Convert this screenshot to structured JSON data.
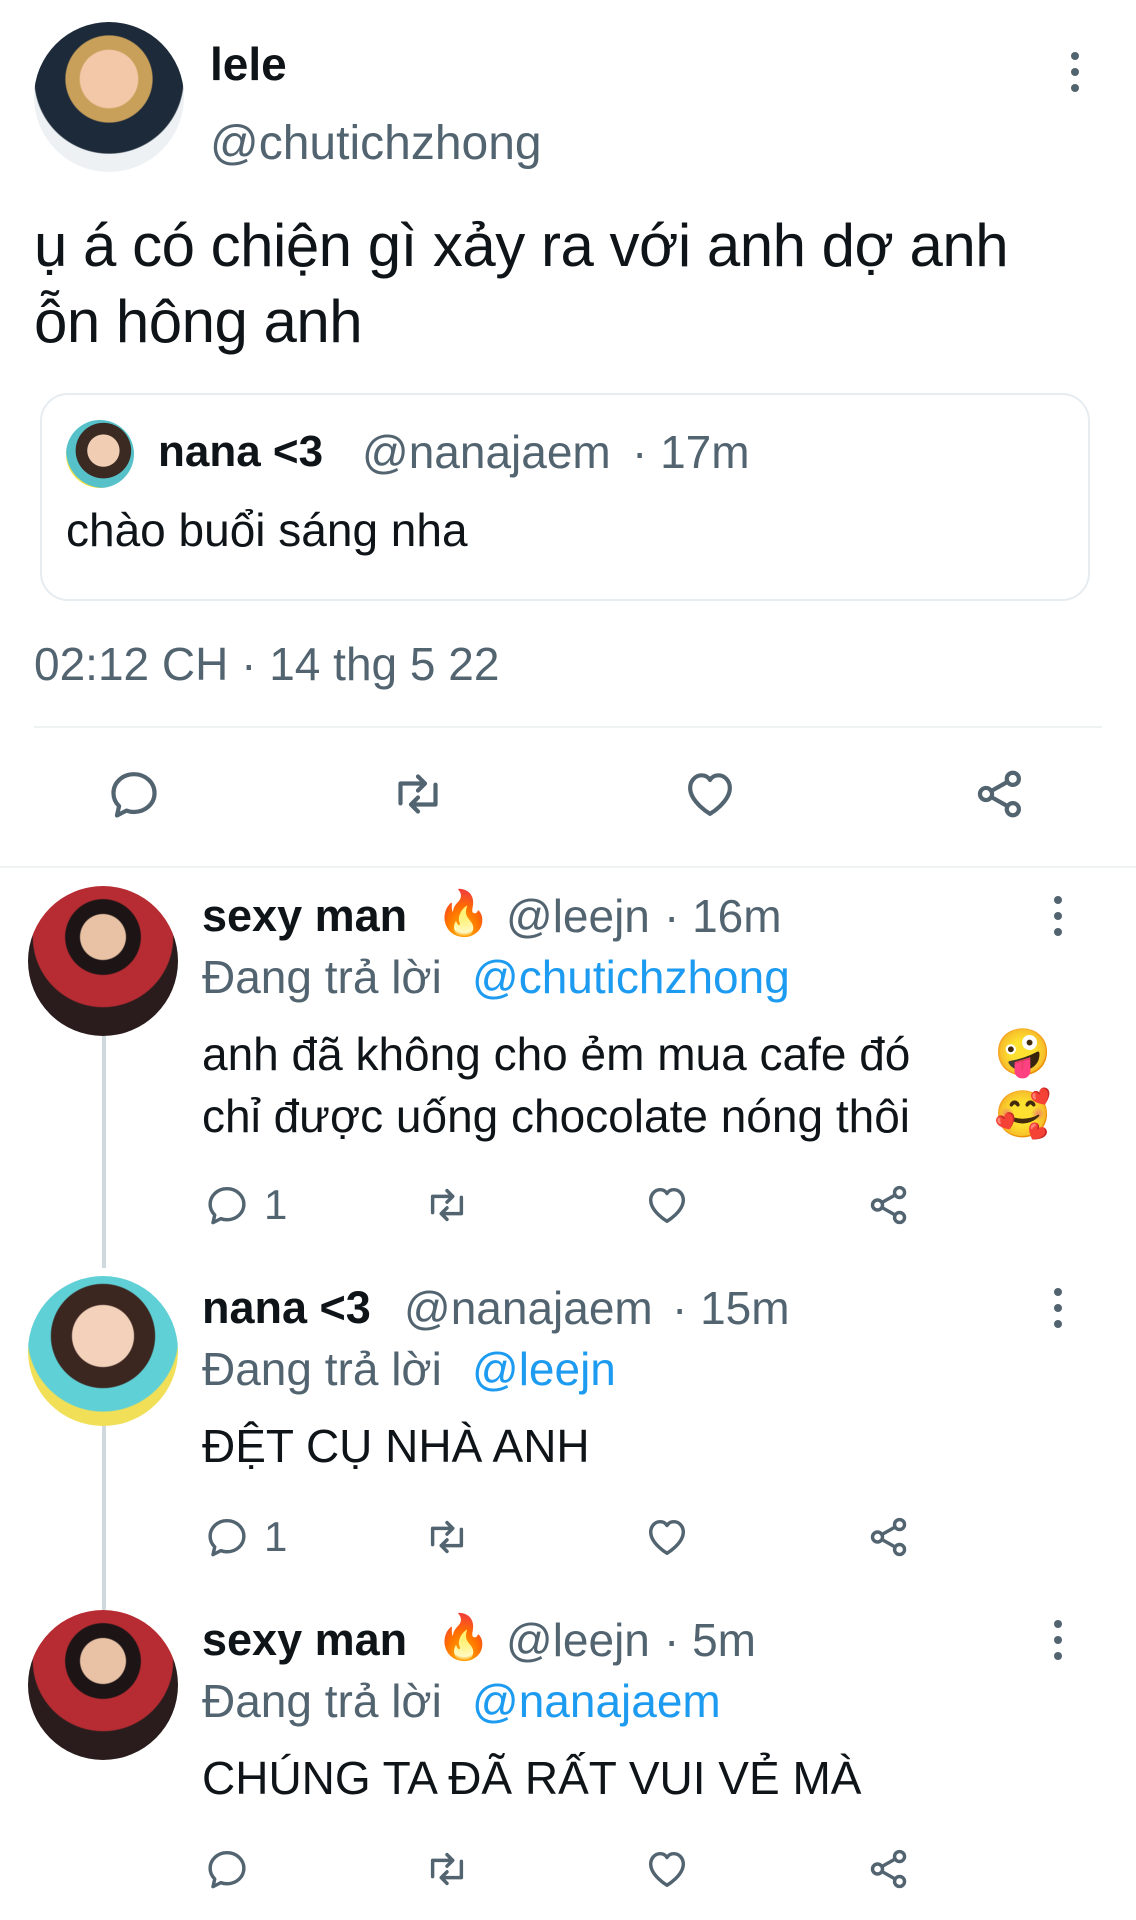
{
  "main_tweet": {
    "name": "lele",
    "handle": "@chutichzhong",
    "text_line1": "ụ á có chiện gì xảy ra với anh dợ anh",
    "text_line2": "ỗn hông anh",
    "quoted": {
      "name": "nana <3",
      "handle": "@nanajaem",
      "time": "· 17m",
      "text": "chào buổi sáng nha"
    },
    "timestamp": "02:12 CH · 14 thg 5 22"
  },
  "actions": {
    "reply_icon": "reply-icon",
    "retweet_icon": "retweet-icon",
    "like_icon": "heart-icon",
    "share_icon": "share-icon"
  },
  "replies": [
    {
      "name": "sexy man",
      "emoji": "🔥",
      "handle": "@leejn",
      "time": "· 16m",
      "replying_prefix": "Đang trả lời",
      "replying_to": "@chutichzhong",
      "line1": "anh đã không cho ẻm mua cafe đó",
      "line1_emoji": "🤪",
      "line2": "chỉ được uống chocolate nóng thôi",
      "line2_emoji": "🥰",
      "reply_count": "1"
    },
    {
      "name": "nana <3",
      "handle": "@nanajaem",
      "time": "· 15m",
      "replying_prefix": "Đang trả lời",
      "replying_to": "@leejn",
      "line1": "ĐỆT CỤ NHÀ ANH",
      "reply_count": "1"
    },
    {
      "name": "sexy man",
      "emoji": "🔥",
      "handle": "@leejn",
      "time": "· 5m",
      "replying_prefix": "Đang trả lời",
      "replying_to": "@nanajaem",
      "line1": "CHÚNG TA ĐÃ RẤT VUI VẺ MÀ"
    }
  ],
  "colors": {
    "accent": "#1d9bf0",
    "muted": "#536471",
    "divider": "#eff3f4"
  }
}
